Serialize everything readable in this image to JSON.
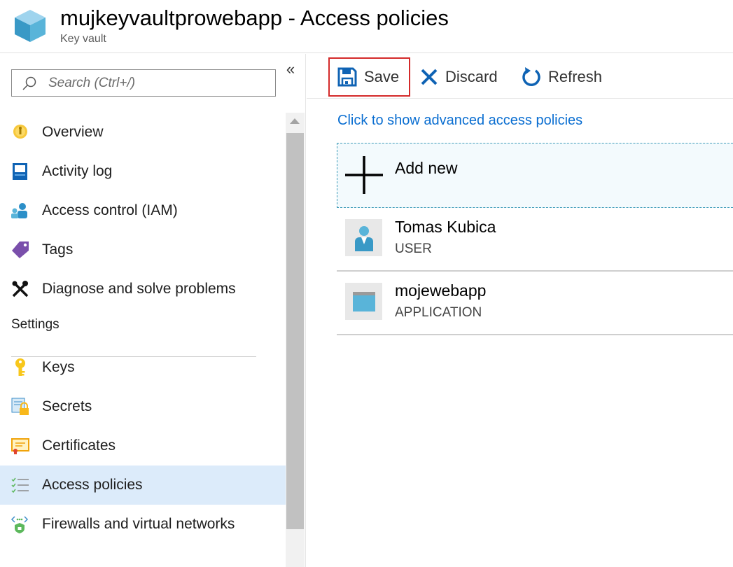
{
  "header": {
    "title": "mujkeyvaultprowebapp - Access policies",
    "subtitle": "Key vault",
    "logo_icon": "key-vault-cube-icon"
  },
  "sidebar": {
    "search": {
      "placeholder": "Search (Ctrl+/)",
      "value": ""
    },
    "collapse_label": "«",
    "items": [
      {
        "label": "Overview",
        "icon": "overview-bulb-icon"
      },
      {
        "label": "Activity log",
        "icon": "activity-log-book-icon"
      },
      {
        "label": "Access control (IAM)",
        "icon": "people-icon"
      },
      {
        "label": "Tags",
        "icon": "tag-icon"
      },
      {
        "label": "Diagnose and solve problems",
        "icon": "wrench-screwdriver-icon"
      }
    ],
    "settings_heading": "Settings",
    "settings_items": [
      {
        "label": "Keys",
        "icon": "key-icon"
      },
      {
        "label": "Secrets",
        "icon": "secret-lock-icon"
      },
      {
        "label": "Certificates",
        "icon": "certificate-icon"
      },
      {
        "label": "Access policies",
        "icon": "access-policies-list-icon",
        "active": true
      },
      {
        "label": "Firewalls and virtual networks",
        "icon": "firewall-network-icon"
      }
    ]
  },
  "toolbar": {
    "save_label": "Save",
    "discard_label": "Discard",
    "refresh_label": "Refresh"
  },
  "content": {
    "advanced_link": "Click to show advanced access policies",
    "add_new_label": "Add new",
    "policies": [
      {
        "name": "Tomas Kubica",
        "type": "USER",
        "icon": "user-avatar-icon"
      },
      {
        "name": "mojewebapp",
        "type": "APPLICATION",
        "icon": "application-window-icon"
      }
    ]
  },
  "colors": {
    "accent": "#0a6ed1",
    "active_bg": "#dcebfa",
    "save_border": "#d42a2a",
    "add_new_bg": "#f3fafd"
  }
}
